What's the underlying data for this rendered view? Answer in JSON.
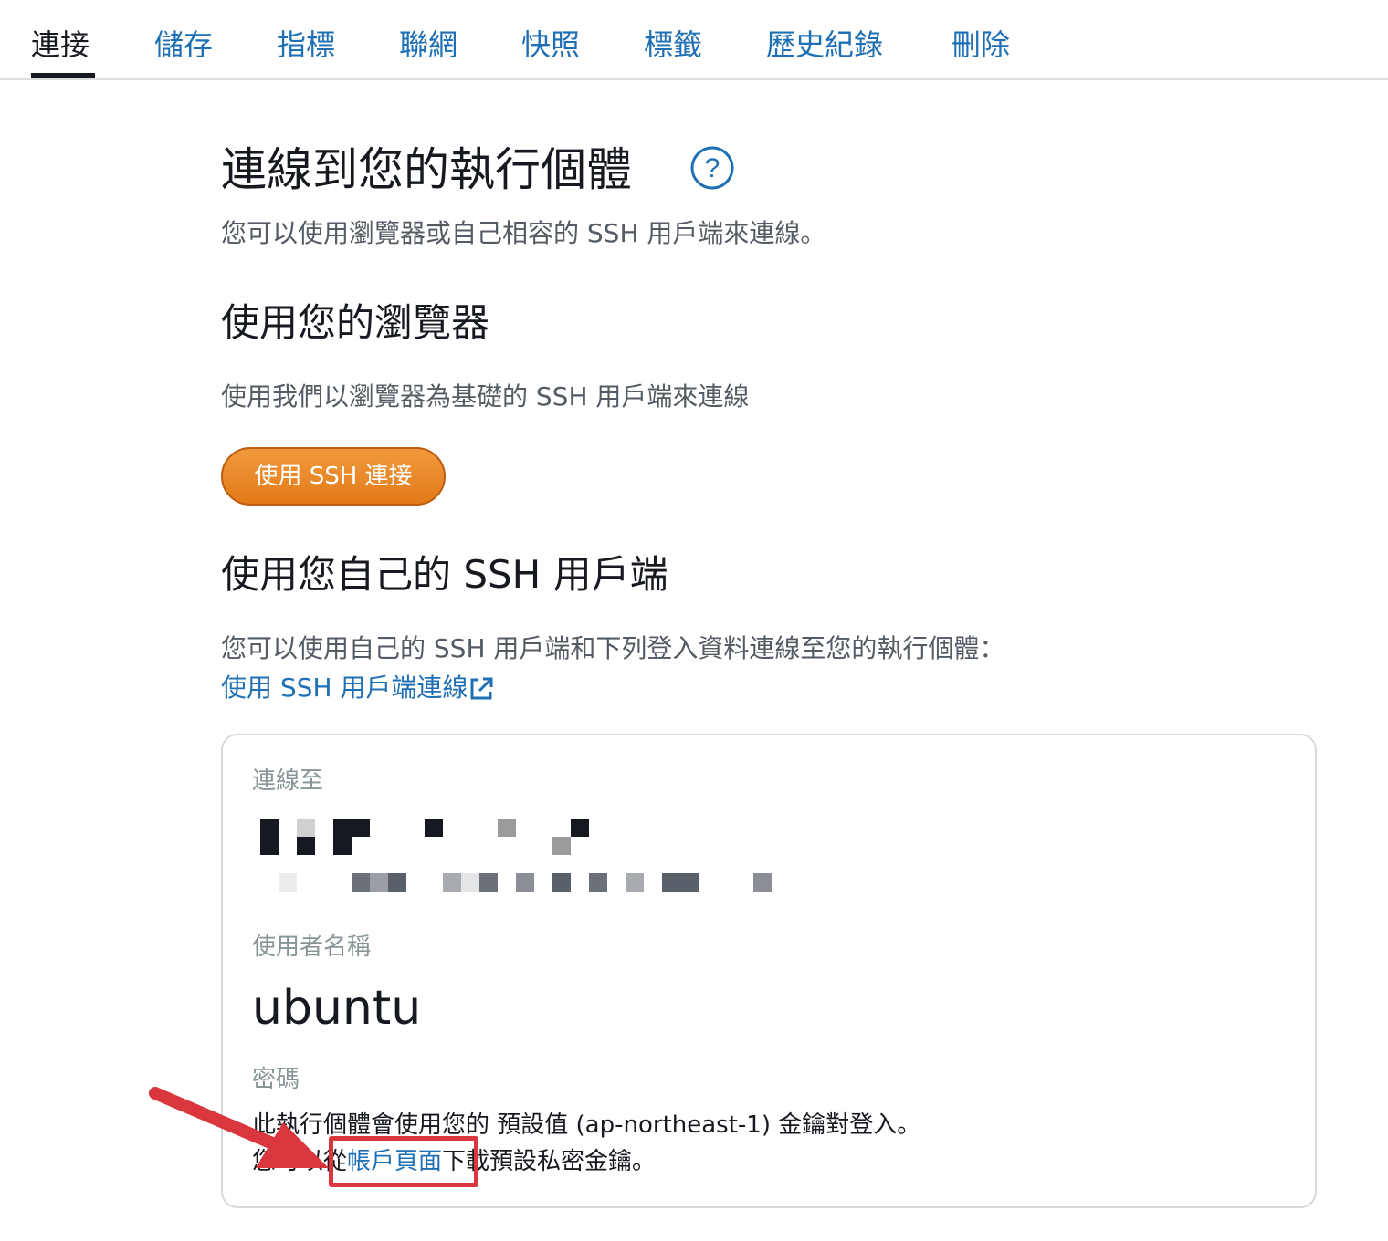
{
  "tabs": [
    {
      "label": "連接",
      "active": true
    },
    {
      "label": "儲存",
      "active": false
    },
    {
      "label": "指標",
      "active": false
    },
    {
      "label": "聯網",
      "active": false
    },
    {
      "label": "快照",
      "active": false
    },
    {
      "label": "標籤",
      "active": false
    },
    {
      "label": "歷史紀錄",
      "active": false
    },
    {
      "label": "刪除",
      "active": false
    }
  ],
  "connect": {
    "title": "連線到您的執行個體",
    "help_icon": "question-circle-icon",
    "subtitle": "您可以使用瀏覽器或自己相容的 SSH 用戶端來連線。"
  },
  "browser_section": {
    "heading": "使用您的瀏覽器",
    "description": "使用我們以瀏覽器為基礎的 SSH 用戶端來連線",
    "button_label": "使用 SSH 連接",
    "button_color": "#ec8b2a"
  },
  "own_client_section": {
    "heading": "使用您自己的 SSH 用戶端",
    "description": "您可以使用自己的 SSH 用戶端和下列登入資料連線至您的執行個體：",
    "link_label": "使用 SSH 用戶端連線",
    "link_icon": "external-link-icon"
  },
  "details": {
    "connect_to_label": "連線至",
    "username_label": "使用者名稱",
    "username_value": "ubuntu",
    "password_label": "密碼",
    "password_line1": "此執行個體會使用您的 預設值 (ap-northeast-1) 金鑰對登入。",
    "password_line2_prefix": "您可以從",
    "password_line2_link": "帳戶頁面",
    "password_line2_suffix": "下載預設私密金鑰。"
  },
  "colors": {
    "link": "#1f6fb5",
    "annotation": "#d9363e",
    "text_dark": "#16191f",
    "text_muted": "#545b64"
  }
}
